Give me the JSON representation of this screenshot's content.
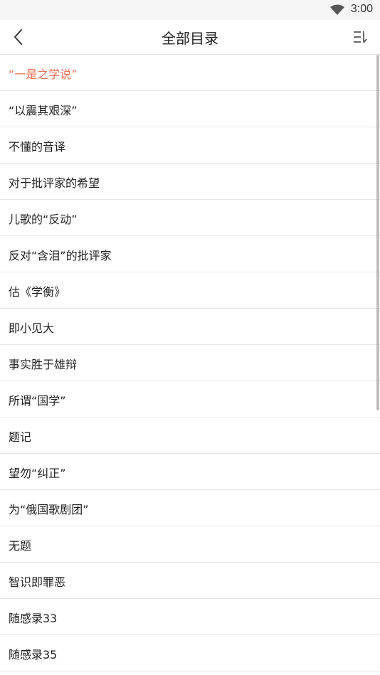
{
  "status_bar": {
    "time": "3:00",
    "wifi_icon": "wifi-icon"
  },
  "header": {
    "title": "全部目录",
    "back_icon": "chevron-left-icon",
    "sort_icon": "sort-icon"
  },
  "chapters": [
    {
      "label": "“一是之学说”",
      "active": true
    },
    {
      "label": "“以震其艰深”",
      "active": false
    },
    {
      "label": "不懂的音译",
      "active": false
    },
    {
      "label": "对于批评家的希望",
      "active": false
    },
    {
      "label": "儿歌的“反动”",
      "active": false
    },
    {
      "label": "反对“含泪”的批评家",
      "active": false
    },
    {
      "label": "估《学衡》",
      "active": false
    },
    {
      "label": "即小见大",
      "active": false
    },
    {
      "label": "事实胜于雄辩",
      "active": false
    },
    {
      "label": "所谓“国学”",
      "active": false
    },
    {
      "label": "题记",
      "active": false
    },
    {
      "label": "望勿“纠正”",
      "active": false
    },
    {
      "label": "为“俄国歌剧团”",
      "active": false
    },
    {
      "label": "无题",
      "active": false
    },
    {
      "label": "智识即罪恶",
      "active": false
    },
    {
      "label": "随感录33",
      "active": false
    },
    {
      "label": "随感录35",
      "active": false
    }
  ],
  "colors": {
    "active_text": "#e8735a",
    "text": "#222222",
    "divider": "#e6e6e6"
  }
}
